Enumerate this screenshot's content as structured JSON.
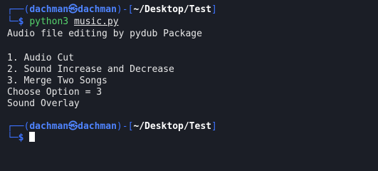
{
  "prompt1": {
    "bracket_open": "┌──(",
    "user": "dachman",
    "at_symbol": "㉿",
    "host": "dachman",
    "mid": ")-[",
    "path": "~/Desktop/Test",
    "bracket_close": "]",
    "branch": "└─",
    "dollar": "$",
    "command": "python3",
    "argument": "music.py"
  },
  "output": {
    "title": "Audio file editing by pydub Package",
    "option1": "1. Audio Cut",
    "option2": "2. Sound Increase and Decrease",
    "option3": "3. Merge Two Songs",
    "choice": "Choose Option = 3",
    "result": "Sound Overlay"
  },
  "prompt2": {
    "bracket_open": "┌──(",
    "user": "dachman",
    "at_symbol": "㉿",
    "host": "dachman",
    "mid": ")-[",
    "path": "~/Desktop/Test",
    "bracket_close": "]",
    "branch": "└─",
    "dollar": "$"
  },
  "colors": {
    "background": "#1b1e26",
    "prompt_blue": "#3d73ff",
    "command_green": "#55d36c",
    "text": "#e6e6e6"
  }
}
